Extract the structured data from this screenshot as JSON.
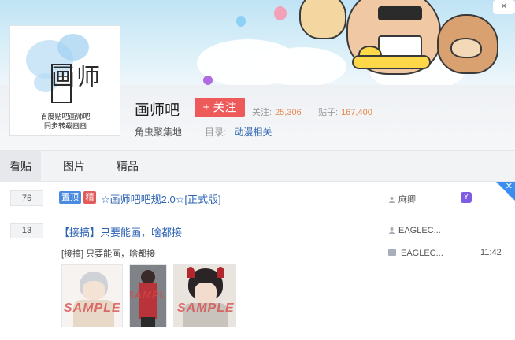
{
  "forum": {
    "name": "画师吧",
    "follow_label": "+ 关注",
    "stats": {
      "follow_label": "关注:",
      "follow_value": "25,306",
      "post_label": "贴子:",
      "post_value": "167,400"
    },
    "description": "角虫聚集地",
    "catalog_label": "目录:",
    "catalog_link": "动漫相关",
    "avatar": {
      "big_text": "画师",
      "slogan_line1": "百度贴吧画师吧",
      "slogan_line2": "同步转载画画"
    }
  },
  "tabs": [
    {
      "label": "看贴",
      "active": true
    },
    {
      "label": "图片",
      "active": false
    },
    {
      "label": "精品",
      "active": false
    }
  ],
  "threads": [
    {
      "reply_count": "76",
      "badges": [
        "置顶",
        "精"
      ],
      "title": "☆画师吧吧规2.0☆[正式版]",
      "author": "麻卿",
      "vip_badge": "Y"
    },
    {
      "reply_count": "13",
      "title": "【接搞】只要能画，啥都接",
      "author": "EAGLEC...",
      "abstract": "[接搞] 只要能画，啥都接",
      "last_reply_author": "EAGLEC...",
      "last_reply_time": "11:42",
      "thumb_watermark": "SAMPLE"
    }
  ],
  "colors": {
    "accent": "#ee5a5a",
    "link": "#2d64b3",
    "stat_number": "#e8864a",
    "corner": "#3b8ef0"
  }
}
